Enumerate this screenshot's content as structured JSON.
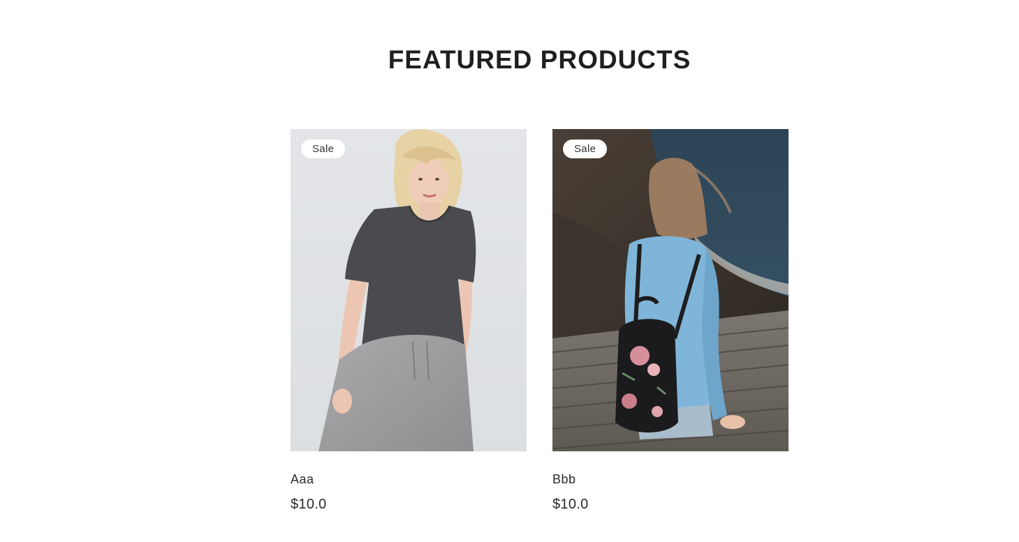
{
  "section": {
    "title": "FEATURED PRODUCTS"
  },
  "products": [
    {
      "badge": "Sale",
      "name": "Aaa",
      "price": "$10.0",
      "image": "woman-grey-tshirt-photo"
    },
    {
      "badge": "Sale",
      "name": "Bbb",
      "price": "$10.0",
      "image": "woman-with-floral-backpack-photo"
    }
  ],
  "colors": {
    "text": "#222222",
    "badge_bg": "#ffffff"
  }
}
